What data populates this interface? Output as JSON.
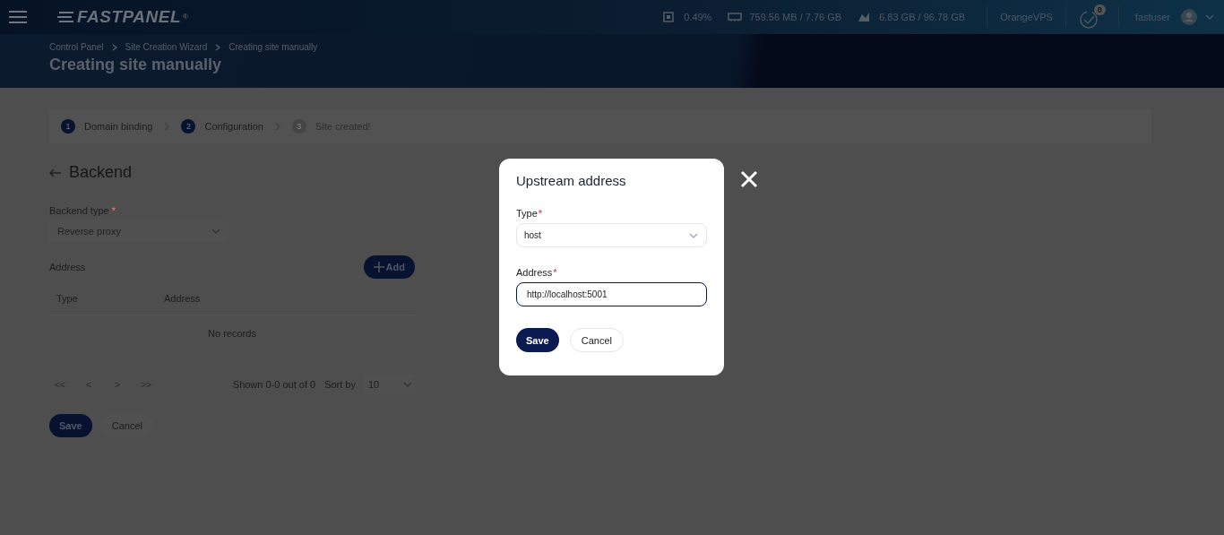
{
  "header": {
    "logo": "FASTPANEL",
    "logo_mark": "®",
    "stats": [
      {
        "kind": "cpu",
        "value": "0.49%"
      },
      {
        "kind": "ram",
        "value": "759.56 MB / 7.76 GB"
      },
      {
        "kind": "disk",
        "value": "6.83 GB / 96.78 GB"
      }
    ],
    "server": "OrangeVPS",
    "notifications": "0",
    "user": "fastuser"
  },
  "breadcrumbs": [
    "Control Panel",
    "Site Creation Wizard",
    "Creating site manually"
  ],
  "page_title": "Creating site manually",
  "steps": [
    {
      "number": "1",
      "label": "Domain binding",
      "active": true
    },
    {
      "number": "2",
      "label": "Configuration",
      "active": true
    },
    {
      "number": "3",
      "label": "Site created!",
      "active": false
    }
  ],
  "section": {
    "title": "Backend",
    "backend_type": {
      "label": "Backend type",
      "required_mark": "*",
      "value": "Reverse proxy"
    },
    "address_label": "Address",
    "add_button": "Add",
    "table": {
      "columns": [
        "Type",
        "Address"
      ],
      "empty": "No records"
    },
    "pagination": {
      "buttons": [
        {
          "label": "<<",
          "disabled": true
        },
        {
          "label": "<",
          "disabled": true
        },
        {
          "label": ">",
          "disabled": true
        },
        {
          "label": ">>",
          "disabled": true
        }
      ],
      "shown": "Shown 0-0 out of 0",
      "sort_label": "Sort by",
      "page_size": "10"
    },
    "buttons": [
      {
        "kind": "primary",
        "label": "Save"
      },
      {
        "kind": "secondary",
        "label": "Cancel"
      }
    ]
  },
  "modal": {
    "title": "Upstream address",
    "fields": [
      {
        "kind": "select",
        "label": "Type",
        "required_mark": "*",
        "value": "host",
        "focused": false
      },
      {
        "kind": "input",
        "label": "Address",
        "required_mark": "*",
        "value": "http://localhost:5001",
        "focused": true
      }
    ],
    "buttons": [
      {
        "kind": "primary",
        "label": "Save"
      },
      {
        "kind": "secondary",
        "label": "Cancel"
      }
    ]
  }
}
